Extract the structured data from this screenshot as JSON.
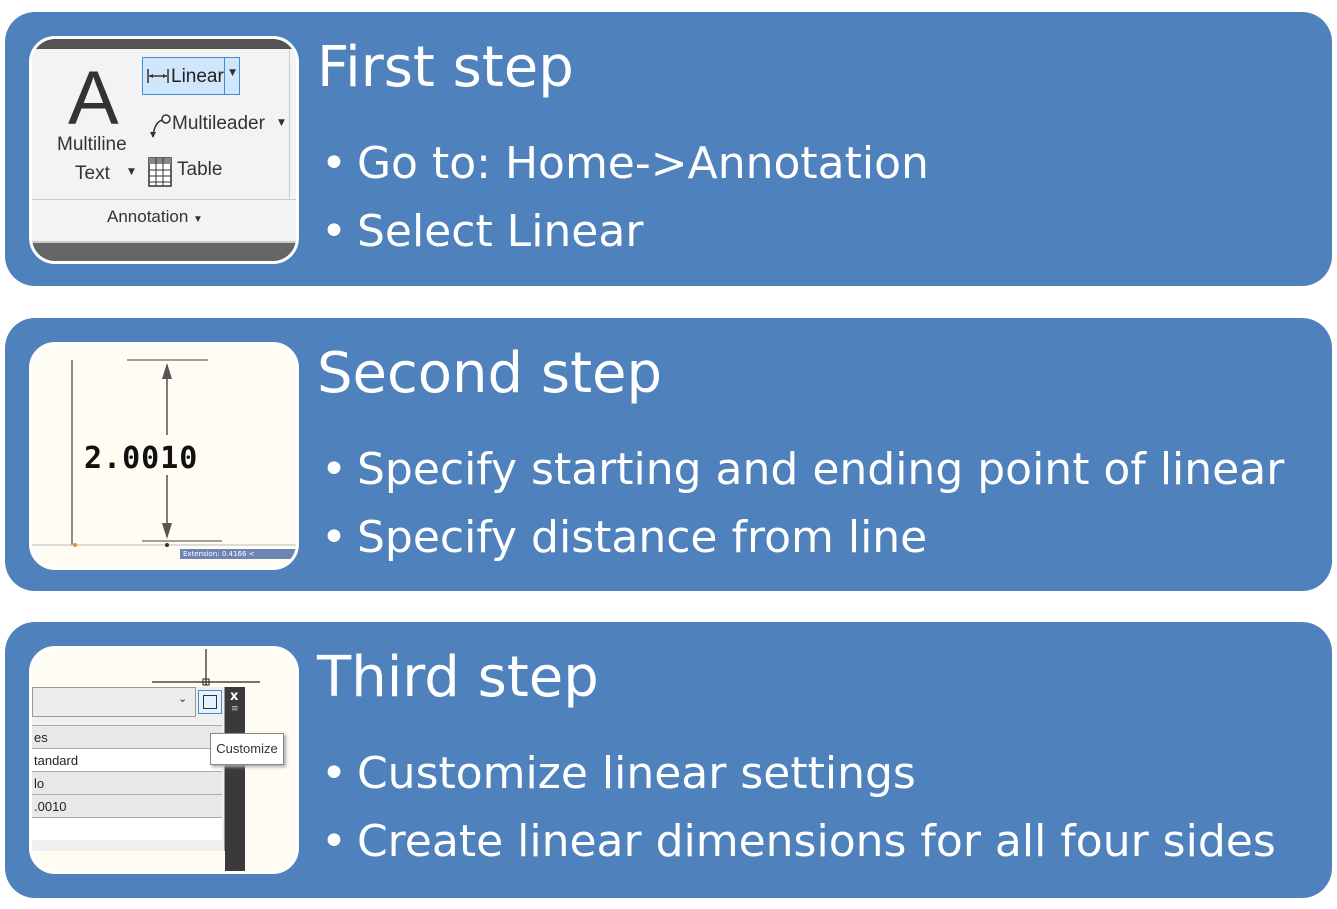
{
  "steps": [
    {
      "title": "First step",
      "bullets": [
        "Go to: Home->Annotation",
        "Select Linear"
      ],
      "thumbnail": {
        "big_letter": "A",
        "multiline": "Multiline",
        "text": "Text",
        "linear": "Linear",
        "multileader": "Multileader",
        "table": "Table",
        "annotation": "Annotation"
      }
    },
    {
      "title": "Second step",
      "bullets": [
        "Specify starting and ending point of linear",
        "Specify distance from line"
      ],
      "thumbnail": {
        "dimension_value": "2.0010",
        "extension_label": "Extension: 0.4166 <"
      }
    },
    {
      "title": "Third step",
      "bullets": [
        "Customize linear settings",
        "Create linear dimensions for all four sides"
      ],
      "thumbnail": {
        "tooltip": "Customize",
        "rows": [
          "es",
          "tandard",
          "lo",
          ".0010",
          ""
        ]
      }
    }
  ],
  "colors": {
    "panel": "#4f81bd",
    "text": "#ffffff"
  }
}
